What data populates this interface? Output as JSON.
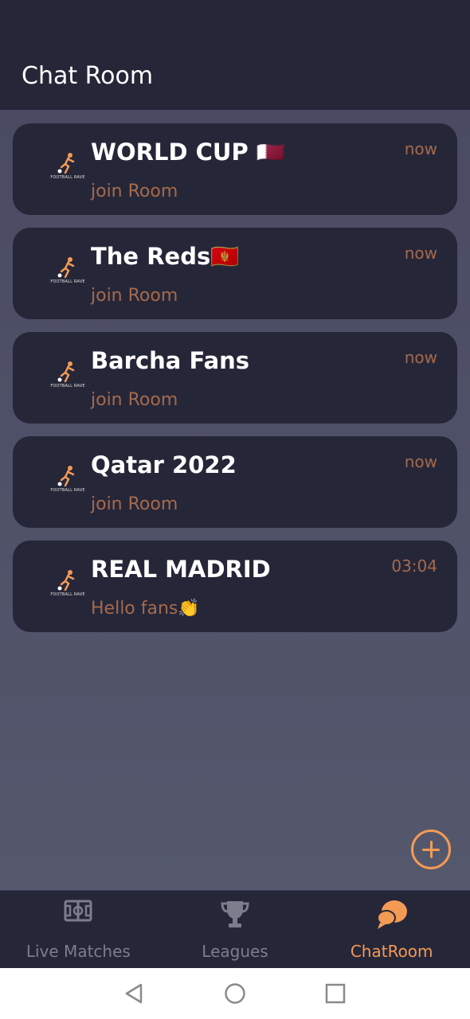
{
  "header": {
    "title": "Chat Room"
  },
  "logo": {
    "text": "FOOTBALL RAVE"
  },
  "rooms": [
    {
      "name": "WORLD CUP 🇶🇦",
      "subtitle": "join Room",
      "time": "now"
    },
    {
      "name": "The Reds🇲🇪",
      "subtitle": "join Room",
      "time": "now"
    },
    {
      "name": "Barcha Fans",
      "subtitle": "join Room",
      "time": "now"
    },
    {
      "name": "Qatar 2022",
      "subtitle": "join Room",
      "time": "now"
    },
    {
      "name": "REAL MADRID",
      "subtitle": "Hello fans👏",
      "time": "03:04"
    }
  ],
  "fab": {
    "icon": "plus-circle-icon"
  },
  "bottom_nav": {
    "items": [
      {
        "label": "Live Matches",
        "icon": "stadium-icon",
        "active": false
      },
      {
        "label": "Leagues",
        "icon": "trophy-icon",
        "active": false
      },
      {
        "label": "ChatRoom",
        "icon": "chat-bubbles-icon",
        "active": true
      }
    ]
  },
  "system_nav": {
    "icons": [
      "back-icon",
      "home-icon",
      "recents-icon"
    ]
  },
  "colors": {
    "background": "#4f5168",
    "card": "#262639",
    "accent": "#f39a55",
    "subtitle": "#a56a4a",
    "inactive": "#7c7d8c"
  }
}
